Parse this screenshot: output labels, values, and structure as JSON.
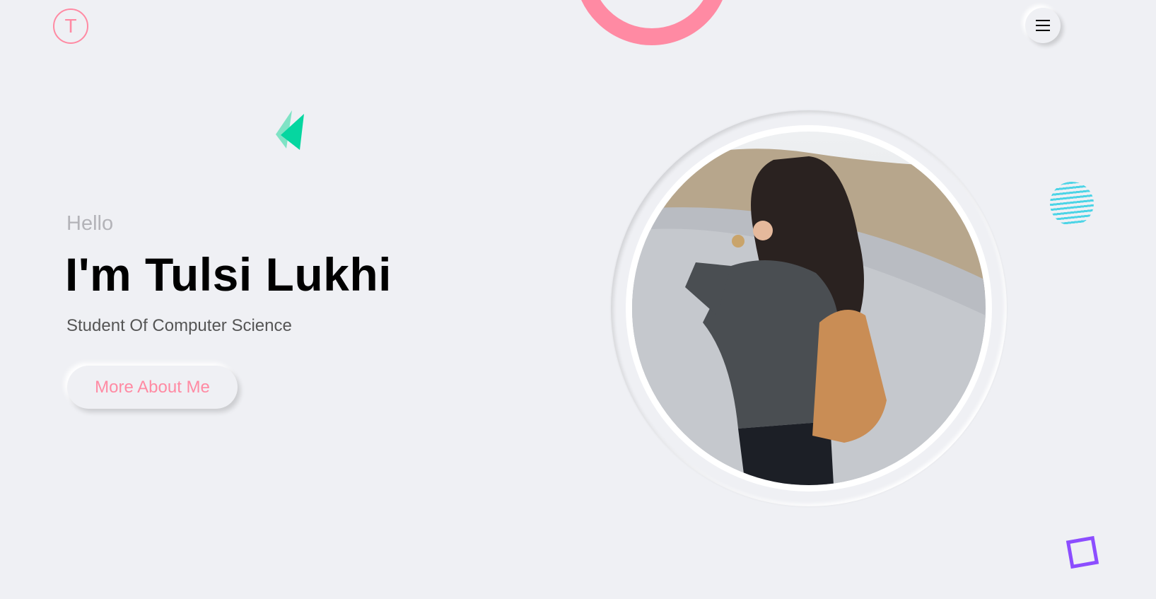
{
  "header": {
    "logo_letter": "T",
    "menu_icon": "hamburger-menu-icon"
  },
  "hero": {
    "greeting": "Hello",
    "name": "I'm Tulsi Lukhi",
    "subtitle": "Student Of Computer Science",
    "cta_label": "More About Me"
  },
  "colors": {
    "background": "#eff0f4",
    "accent_pink": "#ff8aa3",
    "green": "#06d6a0",
    "cyan": "#4dd4e6",
    "purple": "#8c4dff"
  }
}
